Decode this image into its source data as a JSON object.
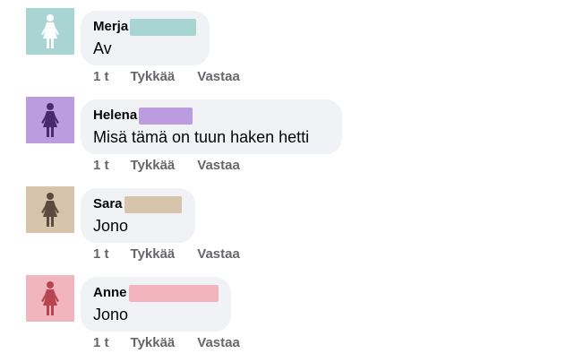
{
  "comments": [
    {
      "author": "Merja",
      "text": "Av",
      "time": "1 t",
      "like_label": "Tykkää",
      "reply_label": "Vastaa",
      "avatar_bg": "#a8d5d2",
      "avatar_figure": "#ffffff",
      "redaction_color": "#a8d5d2",
      "icon": "female-person-icon"
    },
    {
      "author": "Helena",
      "text": "Misä tämä on tuun haken hetti",
      "time": "1 t",
      "like_label": "Tykkää",
      "reply_label": "Vastaa",
      "avatar_bg": "#bb9ddf",
      "avatar_figure": "#4a2a6e",
      "redaction_color": "#bb9ddf",
      "icon": "female-person-icon"
    },
    {
      "author": "Sara",
      "text": "Jono",
      "time": "1 t",
      "like_label": "Tykkää",
      "reply_label": "Vastaa",
      "avatar_bg": "#d7c4ad",
      "avatar_figure": "#5b4a3e",
      "redaction_color": "#d7c4ad",
      "icon": "female-person-icon"
    },
    {
      "author": "Anne",
      "text": "Jono",
      "time": "1 t",
      "like_label": "Tykkää",
      "reply_label": "Vastaa",
      "avatar_bg": "#f2b5bd",
      "avatar_figure": "#b7454f",
      "redaction_color": "#f2b5bd",
      "icon": "female-person-icon"
    }
  ]
}
